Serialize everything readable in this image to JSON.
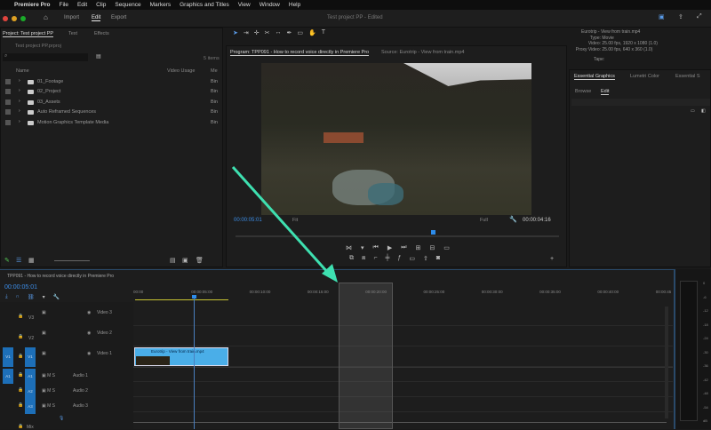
{
  "menubar": {
    "app": "Premiere Pro",
    "items": [
      "File",
      "Edit",
      "Clip",
      "Sequence",
      "Markers",
      "Graphics and Titles",
      "View",
      "Window",
      "Help"
    ]
  },
  "appbar": {
    "workspaces": [
      "Import",
      "Edit",
      "Export"
    ],
    "active": "Edit",
    "title": "Test project PP - Edited"
  },
  "project": {
    "tabs": [
      "Project: Test project PP",
      "Text",
      "Effects"
    ],
    "file": "Test project PP.prproj",
    "count": "5 items",
    "search_placeholder": "",
    "headers": {
      "name": "Name",
      "usage": "Video Usage",
      "media": "Me"
    },
    "rows": [
      {
        "name": "01_Footage",
        "type": "Bin"
      },
      {
        "name": "02_Project",
        "type": "Bin"
      },
      {
        "name": "03_Assets",
        "type": "Bin"
      },
      {
        "name": "Auto Reframed Sequences",
        "type": "Bin"
      },
      {
        "name": "Motion Graphics Template Media",
        "type": "Bin"
      }
    ]
  },
  "program": {
    "tab": "Program: TPP091 - How to record voice directly in Premiere Pro",
    "source_tab": "Source: Eurotrip - View from train.mp4",
    "timecode": "00:00:05:01",
    "fit": "Fit",
    "quality": "Full",
    "duration": "00:00:04:16",
    "playhead_fraction": 0.61
  },
  "metadata": {
    "clip": "Eurotrip - View from train.mp4",
    "type_label": "Type:",
    "type": "Movie",
    "video_label": "Video:",
    "video": "25.00 fps, 1920 x 1080 (1.0)",
    "proxy_label": "Proxy Video:",
    "proxy": "25.00 fps, 640 x 360 (1.0)",
    "tape_label": "Tape:"
  },
  "essential": {
    "tabs": [
      "Essential Graphics",
      "Lumetri Color",
      "Essential S"
    ],
    "subtabs": [
      "Browse",
      "Edit"
    ]
  },
  "timeline": {
    "title": "TPP091 - How to record voice directly in Premiere Pro",
    "timecode": "00:00:05:01",
    "ruler": [
      "00:00",
      "00:00:05:00",
      "00:00:10:00",
      "00:00:15:00",
      "00:00:20:00",
      "00:00:25:00",
      "00:00:30:00",
      "00:00:35:00",
      "00:00:40:00",
      "00:00:45"
    ],
    "video_tracks": [
      {
        "id": "V3",
        "name": "Video 3"
      },
      {
        "id": "V2",
        "name": "Video 2"
      },
      {
        "id": "V1",
        "name": "Video 1"
      }
    ],
    "audio_tracks": [
      {
        "id": "A1",
        "name": "Audio 1"
      },
      {
        "id": "A2",
        "name": "Audio 2"
      },
      {
        "id": "A3",
        "name": "Audio 3"
      }
    ],
    "mix": "Mix",
    "clip": "Eurotrip - View from train.mp4"
  },
  "meter": {
    "labels": [
      "0",
      "-6",
      "-12",
      "-18",
      "-24",
      "-30",
      "-36",
      "-42",
      "-48",
      "-54",
      "dB"
    ]
  },
  "colors": {
    "accent": "#2d8ceb",
    "arrow": "#3ee0b0"
  }
}
